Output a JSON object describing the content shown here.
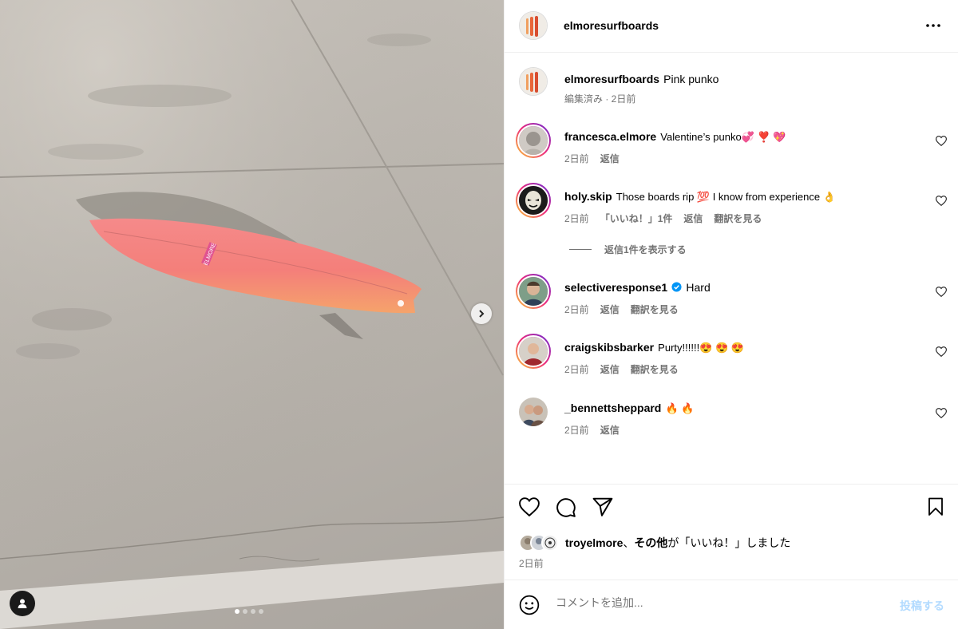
{
  "post": {
    "image_alt": "Pink surfboard on concrete",
    "board_logo_text": "ELMORE",
    "carousel": {
      "count": 4,
      "active_index": 0
    }
  },
  "header": {
    "username": "elmoresurfboards",
    "more_icon": "more-horizontal-icon"
  },
  "caption": {
    "username": "elmoresurfboards",
    "text": "Pink punko",
    "meta": "編集済み · 2日前"
  },
  "comments": [
    {
      "username": "francesca.elmore",
      "text": "Valentine’s punko💞 ❣️ 💖",
      "time": "2日前",
      "reply": "返信",
      "likes": "",
      "translate": ""
    },
    {
      "username": "holy.skip",
      "text": "Those boards rip 💯 I know from experience 👌",
      "time": "2日前",
      "reply": "返信",
      "likes": "「いいね！」1件",
      "translate": "翻訳を見る"
    },
    {
      "username": "selectiveresponse1",
      "text": "Hard",
      "time": "2日前",
      "reply": "返信",
      "likes": "",
      "translate": "翻訳を見る"
    },
    {
      "username": "craigskibsbarker",
      "text": "Purty!!!!!!😍 😍 😍",
      "time": "2日前",
      "reply": "返信",
      "likes": "",
      "translate": "翻訳を見る"
    },
    {
      "username": "_bennettsheppard",
      "text": "🔥 🔥",
      "time": "2日前",
      "reply": "返信",
      "likes": "",
      "translate": ""
    }
  ],
  "view_replies": "返信1件を表示する",
  "actions": {
    "like_icon": "heart-icon",
    "comment_icon": "comment-icon",
    "share_icon": "paper-plane-icon",
    "save_icon": "bookmark-icon"
  },
  "likes": {
    "first_user": "troyelmore",
    "separator": "、",
    "others": "その他",
    "suffix": "が「いいね！」しました"
  },
  "date": "2日前",
  "comment_box": {
    "placeholder": "コメントを追加...",
    "post_label": "投稿する"
  },
  "colors": {
    "accent_blue": "#0095f6",
    "post_disabled": "#b3dbff",
    "verified": "#0095f6",
    "board_pink": "#f48a8a"
  }
}
